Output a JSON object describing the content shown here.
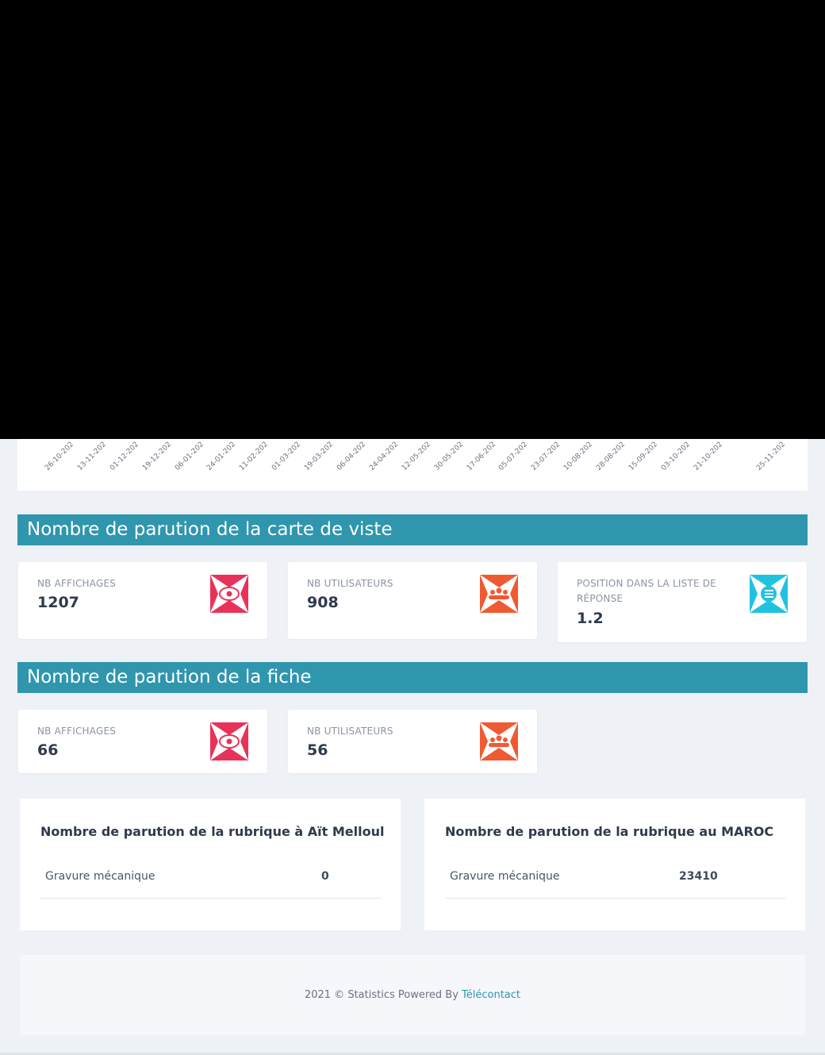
{
  "chart": {
    "x_ticks": [
      "26-10-202",
      "13-11-202",
      "01-12-202",
      "19-12-202",
      "06-01-202",
      "24-01-202",
      "11-02-202",
      "01-03-202",
      "19-03-202",
      "06-04-202",
      "24-04-202",
      "12-05-202",
      "30-05-202",
      "17-06-202",
      "05-07-202",
      "23-07-202",
      "10-08-202",
      "28-08-202",
      "15-09-202",
      "03-10-202",
      "21-10-202",
      "25-11-202"
    ]
  },
  "section_carte": {
    "title": "Nombre de parution de la carte de viste",
    "stats": [
      {
        "label": "NB AFFICHAGES",
        "value": "1207",
        "icon": "eye-icon",
        "color": "#e8325a"
      },
      {
        "label": "NB UTILISATEURS",
        "value": "908",
        "icon": "users-icon",
        "color": "#f05a32"
      },
      {
        "label": "POSITION DANS LA LISTE DE RÉPONSE",
        "value": "1.2",
        "icon": "list-icon",
        "color": "#1fc3e0"
      }
    ]
  },
  "section_fiche": {
    "title": "Nombre de parution de la fiche",
    "stats": [
      {
        "label": "NB AFFICHAGES",
        "value": "66",
        "icon": "eye-icon",
        "color": "#e8325a"
      },
      {
        "label": "NB UTILISATEURS",
        "value": "56",
        "icon": "users-icon",
        "color": "#f05a32"
      }
    ]
  },
  "rubrique_local": {
    "title": "Nombre de parution de la rubrique à Aït Melloul",
    "row_name": "Gravure mécanique",
    "row_value": "0"
  },
  "rubrique_maroc": {
    "title": "Nombre de parution de la rubrique au MAROC",
    "row_name": "Gravure mécanique",
    "row_value": "23410"
  },
  "footer": {
    "text": "2021 © Statistics Powered By",
    "link": "Télécontact"
  }
}
